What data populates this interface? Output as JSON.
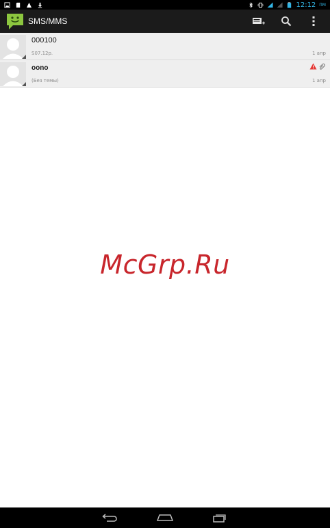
{
  "status_bar": {
    "time": "12:12",
    "time_suffix": "ПМ",
    "left_icons": [
      "gallery-icon",
      "sd-card-icon",
      "warning-icon",
      "download-icon"
    ],
    "right_icons": [
      "bluetooth-icon",
      "vibrate-icon",
      "wifi-icon",
      "signal-icon",
      "battery-icon"
    ]
  },
  "action_bar": {
    "title": "SMS/MMS",
    "app_icon": "messaging-app-icon",
    "actions": [
      "new-message-icon",
      "search-icon",
      "overflow-menu-icon"
    ]
  },
  "conversations": [
    {
      "name": "000100",
      "snippet": "S07.12p.",
      "date": "1 апр",
      "bold": false,
      "icons": []
    },
    {
      "name": "oono",
      "snippet": "(Без темы)",
      "date": "1 апр",
      "bold": true,
      "icons": [
        "error-icon",
        "attachment-icon"
      ]
    }
  ],
  "watermark": "McGrp.Ru",
  "nav_bar": {
    "buttons": [
      "back-icon",
      "home-icon",
      "recent-apps-icon"
    ]
  },
  "colors": {
    "accent": "#33b5e5",
    "action_bar": "#1b1b1b",
    "list_bg": "#efefef",
    "watermark": "#c8262c",
    "app_icon_green": "#8cc63f"
  }
}
